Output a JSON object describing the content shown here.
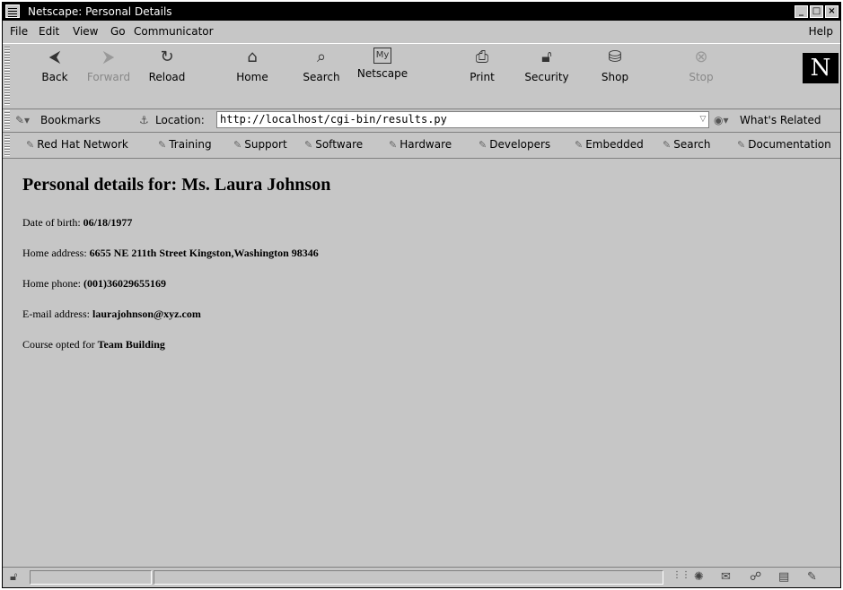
{
  "window": {
    "title": "Netscape: Personal Details"
  },
  "menu": {
    "file": "File",
    "edit": "Edit",
    "view": "View",
    "go": "Go",
    "communicator": "Communicator",
    "help": "Help"
  },
  "nav": {
    "back": "Back",
    "forward": "Forward",
    "reload": "Reload",
    "home": "Home",
    "search": "Search",
    "netscape": "Netscape",
    "print": "Print",
    "security": "Security",
    "shop": "Shop",
    "stop": "Stop",
    "logo": "N"
  },
  "location": {
    "bookmarks": "Bookmarks",
    "label": "Location:",
    "url": "http://localhost/cgi-bin/results.py",
    "related": "What's Related"
  },
  "personal_toolbar": [
    "Red Hat Network",
    "Training",
    "Support",
    "Software",
    "Hardware",
    "Developers",
    "Embedded",
    "Search",
    "Documentation"
  ],
  "page": {
    "heading": "Personal details for: Ms. Laura Johnson",
    "dob_label": "Date of birth:",
    "dob": "06/18/1977",
    "address_label": "Home address:",
    "address": "6655 NE 211th Street Kingston,Washington 98346",
    "phone_label": "Home phone:",
    "phone": "(001)36029655169",
    "email_label": "E-mail address:",
    "email": "laurajohnson@xyz.com",
    "course_label": "Course opted for",
    "course": "Team Building"
  }
}
